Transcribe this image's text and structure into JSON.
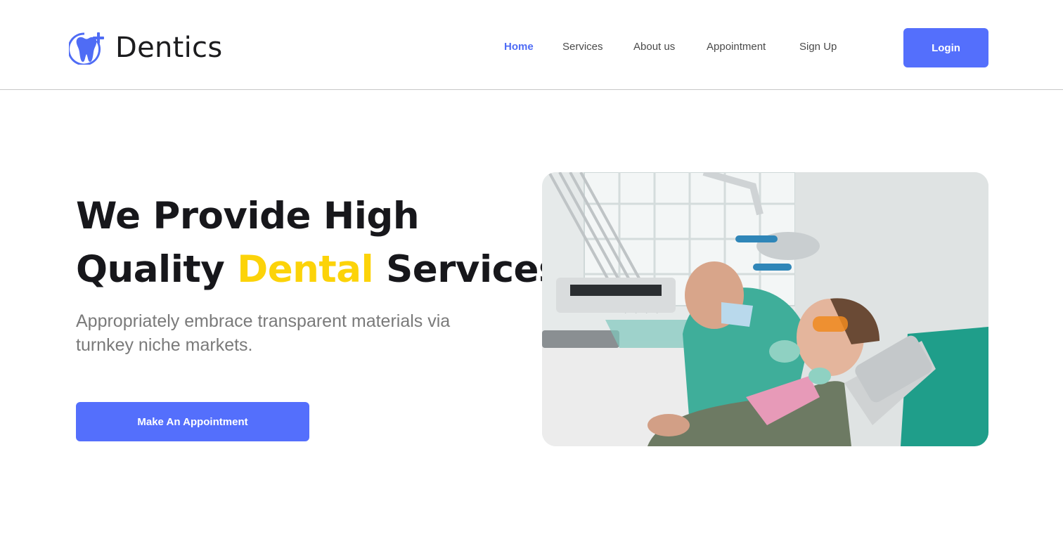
{
  "brand": {
    "name": "Dentics",
    "color": "#4f6cf5"
  },
  "nav": {
    "items": [
      {
        "label": "Home",
        "active": true
      },
      {
        "label": "Services",
        "active": false
      },
      {
        "label": "About us",
        "active": false
      },
      {
        "label": "Appointment",
        "active": false
      },
      {
        "label": "Sign Up",
        "active": false
      }
    ],
    "login_label": "Login"
  },
  "hero": {
    "title_part1": "We Provide High",
    "title_part2": "Quality ",
    "title_accent": "Dental",
    "title_part3": " Services",
    "subtitle": "Appropriately embrace transparent materials via turnkey niche markets.",
    "cta_label": "Make An Appointment",
    "image_icon": "dentist-treating-patient-photo"
  },
  "colors": {
    "primary": "#546ffc",
    "accent": "#fcd309",
    "text_dark": "#17171b",
    "text_muted": "#7a7a7a"
  }
}
